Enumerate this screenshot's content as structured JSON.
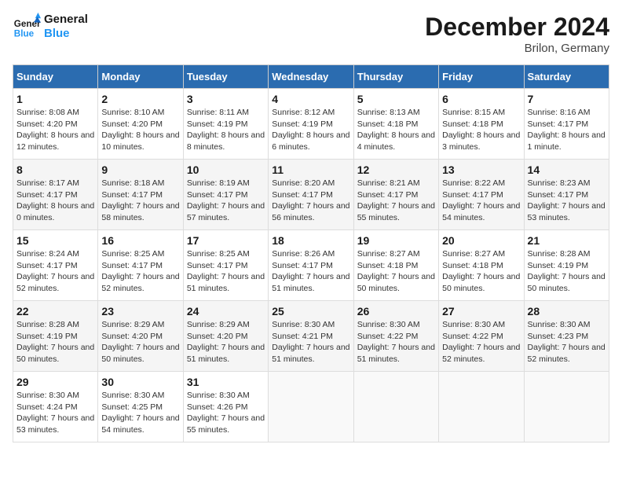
{
  "logo": {
    "line1": "General",
    "line2": "Blue"
  },
  "title": "December 2024",
  "subtitle": "Brilon, Germany",
  "days_header": [
    "Sunday",
    "Monday",
    "Tuesday",
    "Wednesday",
    "Thursday",
    "Friday",
    "Saturday"
  ],
  "weeks": [
    [
      {
        "num": "1",
        "sunrise": "8:08 AM",
        "sunset": "4:20 PM",
        "daylight": "8 hours and 12 minutes."
      },
      {
        "num": "2",
        "sunrise": "8:10 AM",
        "sunset": "4:20 PM",
        "daylight": "8 hours and 10 minutes."
      },
      {
        "num": "3",
        "sunrise": "8:11 AM",
        "sunset": "4:19 PM",
        "daylight": "8 hours and 8 minutes."
      },
      {
        "num": "4",
        "sunrise": "8:12 AM",
        "sunset": "4:19 PM",
        "daylight": "8 hours and 6 minutes."
      },
      {
        "num": "5",
        "sunrise": "8:13 AM",
        "sunset": "4:18 PM",
        "daylight": "8 hours and 4 minutes."
      },
      {
        "num": "6",
        "sunrise": "8:15 AM",
        "sunset": "4:18 PM",
        "daylight": "8 hours and 3 minutes."
      },
      {
        "num": "7",
        "sunrise": "8:16 AM",
        "sunset": "4:17 PM",
        "daylight": "8 hours and 1 minute."
      }
    ],
    [
      {
        "num": "8",
        "sunrise": "8:17 AM",
        "sunset": "4:17 PM",
        "daylight": "8 hours and 0 minutes."
      },
      {
        "num": "9",
        "sunrise": "8:18 AM",
        "sunset": "4:17 PM",
        "daylight": "7 hours and 58 minutes."
      },
      {
        "num": "10",
        "sunrise": "8:19 AM",
        "sunset": "4:17 PM",
        "daylight": "7 hours and 57 minutes."
      },
      {
        "num": "11",
        "sunrise": "8:20 AM",
        "sunset": "4:17 PM",
        "daylight": "7 hours and 56 minutes."
      },
      {
        "num": "12",
        "sunrise": "8:21 AM",
        "sunset": "4:17 PM",
        "daylight": "7 hours and 55 minutes."
      },
      {
        "num": "13",
        "sunrise": "8:22 AM",
        "sunset": "4:17 PM",
        "daylight": "7 hours and 54 minutes."
      },
      {
        "num": "14",
        "sunrise": "8:23 AM",
        "sunset": "4:17 PM",
        "daylight": "7 hours and 53 minutes."
      }
    ],
    [
      {
        "num": "15",
        "sunrise": "8:24 AM",
        "sunset": "4:17 PM",
        "daylight": "7 hours and 52 minutes."
      },
      {
        "num": "16",
        "sunrise": "8:25 AM",
        "sunset": "4:17 PM",
        "daylight": "7 hours and 52 minutes."
      },
      {
        "num": "17",
        "sunrise": "8:25 AM",
        "sunset": "4:17 PM",
        "daylight": "7 hours and 51 minutes."
      },
      {
        "num": "18",
        "sunrise": "8:26 AM",
        "sunset": "4:17 PM",
        "daylight": "7 hours and 51 minutes."
      },
      {
        "num": "19",
        "sunrise": "8:27 AM",
        "sunset": "4:18 PM",
        "daylight": "7 hours and 50 minutes."
      },
      {
        "num": "20",
        "sunrise": "8:27 AM",
        "sunset": "4:18 PM",
        "daylight": "7 hours and 50 minutes."
      },
      {
        "num": "21",
        "sunrise": "8:28 AM",
        "sunset": "4:19 PM",
        "daylight": "7 hours and 50 minutes."
      }
    ],
    [
      {
        "num": "22",
        "sunrise": "8:28 AM",
        "sunset": "4:19 PM",
        "daylight": "7 hours and 50 minutes."
      },
      {
        "num": "23",
        "sunrise": "8:29 AM",
        "sunset": "4:20 PM",
        "daylight": "7 hours and 50 minutes."
      },
      {
        "num": "24",
        "sunrise": "8:29 AM",
        "sunset": "4:20 PM",
        "daylight": "7 hours and 51 minutes."
      },
      {
        "num": "25",
        "sunrise": "8:30 AM",
        "sunset": "4:21 PM",
        "daylight": "7 hours and 51 minutes."
      },
      {
        "num": "26",
        "sunrise": "8:30 AM",
        "sunset": "4:22 PM",
        "daylight": "7 hours and 51 minutes."
      },
      {
        "num": "27",
        "sunrise": "8:30 AM",
        "sunset": "4:22 PM",
        "daylight": "7 hours and 52 minutes."
      },
      {
        "num": "28",
        "sunrise": "8:30 AM",
        "sunset": "4:23 PM",
        "daylight": "7 hours and 52 minutes."
      }
    ],
    [
      {
        "num": "29",
        "sunrise": "8:30 AM",
        "sunset": "4:24 PM",
        "daylight": "7 hours and 53 minutes."
      },
      {
        "num": "30",
        "sunrise": "8:30 AM",
        "sunset": "4:25 PM",
        "daylight": "7 hours and 54 minutes."
      },
      {
        "num": "31",
        "sunrise": "8:30 AM",
        "sunset": "4:26 PM",
        "daylight": "7 hours and 55 minutes."
      },
      null,
      null,
      null,
      null
    ]
  ]
}
